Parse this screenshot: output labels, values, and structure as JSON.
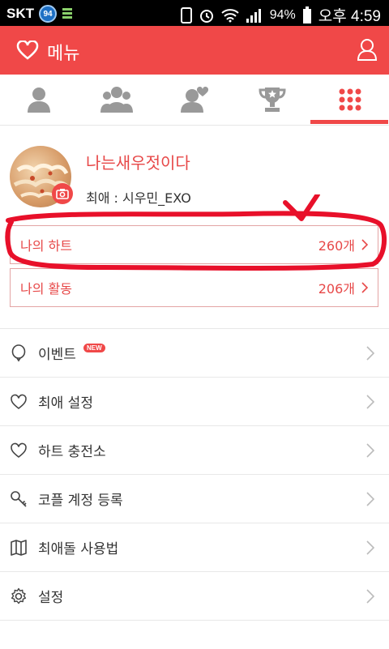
{
  "status_bar": {
    "carrier": "SKT",
    "badge": "94",
    "battery": "94%",
    "time": "오후 4:59"
  },
  "header": {
    "title": "메뉴"
  },
  "tabs": [
    {
      "icon": "single-user-icon"
    },
    {
      "icon": "group-icon"
    },
    {
      "icon": "favorite-user-icon"
    },
    {
      "icon": "trophy-icon"
    },
    {
      "icon": "grid-icon",
      "active": true
    }
  ],
  "profile": {
    "nickname": "나는새우젓이다",
    "favorite": "최애 : 시우민_EXO"
  },
  "stats": [
    {
      "label": "나의 하트",
      "value": "260개"
    },
    {
      "label": "나의 활동",
      "value": "206개"
    }
  ],
  "menu": [
    {
      "label": "이벤트",
      "icon": "balloon-icon",
      "badge": "NEW"
    },
    {
      "label": "최애 설정",
      "icon": "heart-icon"
    },
    {
      "label": "하트 충전소",
      "icon": "heart-icon"
    },
    {
      "label": "코플 계정 등록",
      "icon": "key-icon"
    },
    {
      "label": "최애돌 사용법",
      "icon": "map-icon"
    },
    {
      "label": "설정",
      "icon": "gear-icon"
    }
  ],
  "colors": {
    "accent": "#f04848",
    "annotation": "#e8102a"
  }
}
